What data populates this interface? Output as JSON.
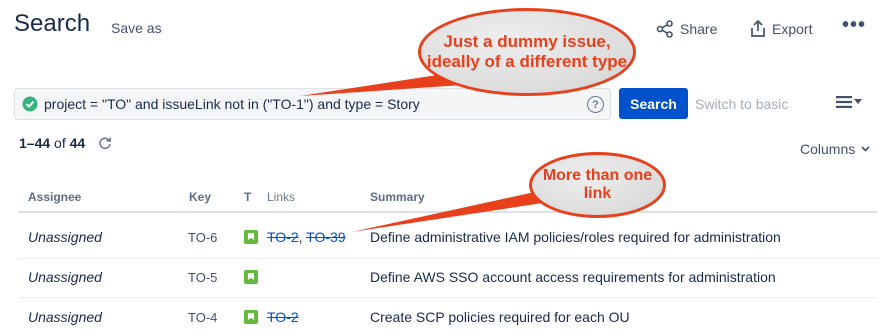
{
  "header": {
    "title": "Search",
    "save_as": "Save as",
    "share": "Share",
    "export": "Export",
    "more": "•••"
  },
  "jql": {
    "status_icon": "check-circle-icon",
    "query": "project = \"TO\" and issueLink not in (\"TO-1\") and type = Story",
    "help": "?"
  },
  "search_button": "Search",
  "switch_basic": "Switch to basic",
  "results": {
    "range": "1–44",
    "of": "of",
    "total": "44"
  },
  "columns_button": "Columns",
  "table": {
    "headers": {
      "assignee": "Assignee",
      "key": "Key",
      "type": "T",
      "links": "Links",
      "summary": "Summary"
    },
    "rows": [
      {
        "assignee": "Unassigned",
        "key": "TO-6",
        "type": "story",
        "links": [
          "TO-2",
          "TO-39"
        ],
        "summary": "Define administrative IAM policies/roles required for administration"
      },
      {
        "assignee": "Unassigned",
        "key": "TO-5",
        "type": "story",
        "links": [],
        "summary": "Define AWS SSO account access requirements for administration"
      },
      {
        "assignee": "Unassigned",
        "key": "TO-4",
        "type": "story",
        "links": [
          "TO-2"
        ],
        "summary": "Create SCP policies required for each OU"
      }
    ]
  },
  "annotations": {
    "callout1": "Just a dummy issue, ideally of a different type",
    "callout2": "More than one link",
    "color": "#e8401c"
  },
  "colors": {
    "primary": "#0052cc",
    "success": "#36b37e",
    "story": "#63ba3c"
  }
}
